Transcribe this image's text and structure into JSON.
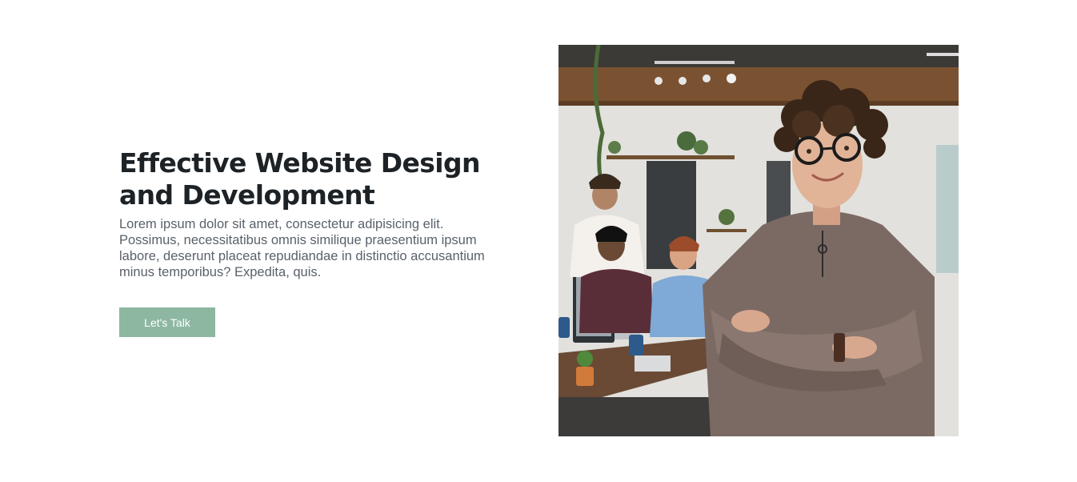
{
  "hero": {
    "title": "Effective Website Design and Development",
    "description": "Lorem ipsum dolor sit amet, consectetur adipisicing elit. Possimus, necessitatibus omnis similique praesentium ipsum labore, deserunt placeat repudiandae in distinctio accusantium minus temporibus? Expedita, quis.",
    "cta_label": "Let's Talk"
  },
  "colors": {
    "accent": "#8db7a1",
    "heading": "#1d2226",
    "body_text": "#5a616a"
  }
}
